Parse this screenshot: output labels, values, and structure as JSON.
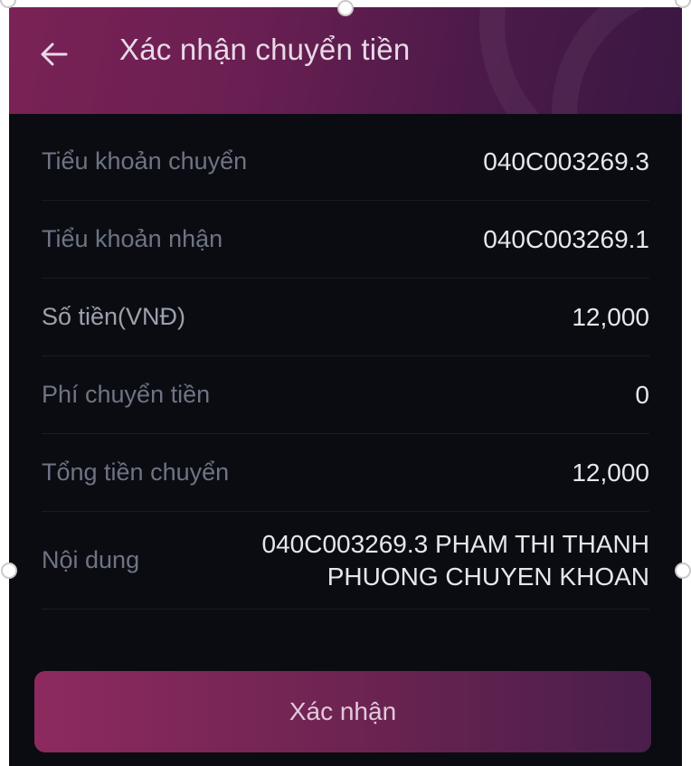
{
  "header": {
    "title": "Xác nhận chuyển tiền",
    "back_icon": "arrow-left-icon"
  },
  "rows": [
    {
      "label": "Tiểu khoản chuyển",
      "value": "040C003269.3"
    },
    {
      "label": "Tiểu khoản nhận",
      "value": "040C003269.1"
    },
    {
      "label": "Số tiền(VNĐ)",
      "value": "12,000"
    },
    {
      "label": "Phí chuyển tiền",
      "value": "0"
    },
    {
      "label": "Tổng tiền chuyển",
      "value": "12,000"
    },
    {
      "label": "Nội dung",
      "value": "040C003269.3 PHAM THI THANH PHUONG CHUYEN KHOAN"
    }
  ],
  "confirm_button": {
    "label": "Xác nhận"
  },
  "colors": {
    "background": "#0b0c11",
    "header_start": "#7a2256",
    "header_end": "#3a1742",
    "button_start": "#8d2a5f",
    "button_end": "#4a1e4b"
  }
}
